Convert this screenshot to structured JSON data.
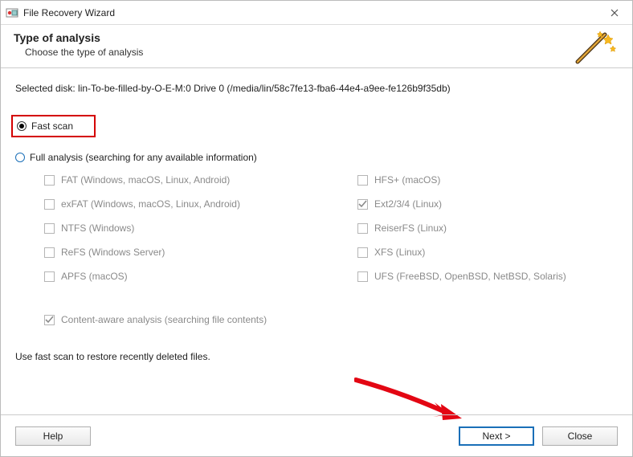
{
  "window": {
    "title": "File Recovery Wizard"
  },
  "header": {
    "title": "Type of analysis",
    "subtitle": "Choose the type of analysis"
  },
  "disk_line": "Selected disk: lin-To-be-filled-by-O-E-M:0 Drive 0 (/media/lin/58c7fe13-fba6-44e4-a9ee-fe126b9f35db)",
  "options": {
    "fast_scan": {
      "label": "Fast scan",
      "selected": true
    },
    "full_analysis": {
      "label": "Full analysis (searching for any available information)",
      "selected": false
    }
  },
  "filesystems": {
    "left": [
      {
        "key": "fat",
        "label": "FAT (Windows, macOS, Linux, Android)",
        "checked": false
      },
      {
        "key": "exfat",
        "label": "exFAT (Windows, macOS, Linux, Android)",
        "checked": false
      },
      {
        "key": "ntfs",
        "label": "NTFS (Windows)",
        "checked": false
      },
      {
        "key": "refs",
        "label": "ReFS (Windows Server)",
        "checked": false
      },
      {
        "key": "apfs",
        "label": "APFS (macOS)",
        "checked": false
      }
    ],
    "right": [
      {
        "key": "hfs",
        "label": "HFS+ (macOS)",
        "checked": false
      },
      {
        "key": "ext",
        "label": "Ext2/3/4 (Linux)",
        "checked": true
      },
      {
        "key": "reiser",
        "label": "ReiserFS (Linux)",
        "checked": false
      },
      {
        "key": "xfs",
        "label": "XFS (Linux)",
        "checked": false
      },
      {
        "key": "ufs",
        "label": "UFS (FreeBSD, OpenBSD, NetBSD, Solaris)",
        "checked": false
      }
    ]
  },
  "content_aware": {
    "label": "Content-aware analysis (searching file contents)",
    "checked": true
  },
  "hint": "Use fast scan to restore recently deleted files.",
  "buttons": {
    "help": "Help",
    "next": "Next >",
    "close": "Close"
  }
}
